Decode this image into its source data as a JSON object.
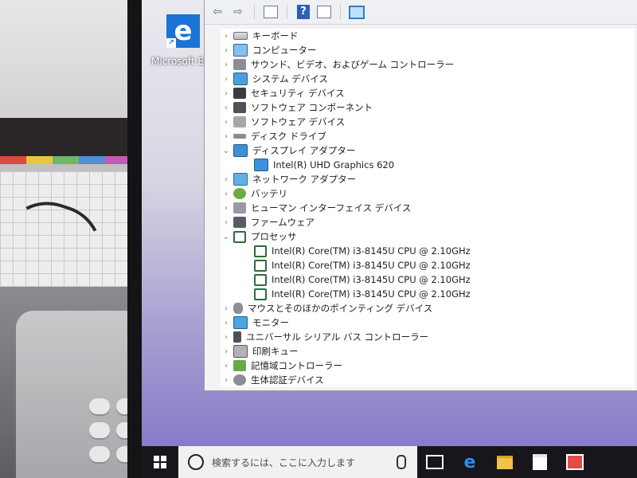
{
  "desktop": {
    "edge_shortcut_label": "Microsoft Ed"
  },
  "device_manager": {
    "categories": [
      {
        "label": "キーボード",
        "icon": "keyboard-icon"
      },
      {
        "label": "コンピューター",
        "icon": "computer-icon"
      },
      {
        "label": "サウンド、ビデオ、およびゲーム コントローラー",
        "icon": "speaker-icon"
      },
      {
        "label": "システム デバイス",
        "icon": "system-icon"
      },
      {
        "label": "セキュリティ デバイス",
        "icon": "security-icon"
      },
      {
        "label": "ソフトウェア コンポーネント",
        "icon": "software-component-icon"
      },
      {
        "label": "ソフトウェア デバイス",
        "icon": "software-device-icon"
      },
      {
        "label": "ディスク ドライブ",
        "icon": "disk-icon"
      },
      {
        "label": "ディスプレイ アダプター",
        "icon": "display-adapter-icon",
        "expanded": true,
        "children": [
          "Intel(R) UHD Graphics 620"
        ]
      },
      {
        "label": "ネットワーク アダプター",
        "icon": "network-icon"
      },
      {
        "label": "バッテリ",
        "icon": "battery-icon"
      },
      {
        "label": "ヒューマン インターフェイス デバイス",
        "icon": "hid-icon"
      },
      {
        "label": "ファームウェア",
        "icon": "firmware-icon"
      },
      {
        "label": "プロセッサ",
        "icon": "processor-icon",
        "expanded": true,
        "children": [
          "Intel(R) Core(TM) i3-8145U CPU @ 2.10GHz",
          "Intel(R) Core(TM) i3-8145U CPU @ 2.10GHz",
          "Intel(R) Core(TM) i3-8145U CPU @ 2.10GHz",
          "Intel(R) Core(TM) i3-8145U CPU @ 2.10GHz"
        ]
      },
      {
        "label": "マウスとそのほかのポインティング デバイス",
        "icon": "mouse-icon"
      },
      {
        "label": "モニター",
        "icon": "monitor-icon"
      },
      {
        "label": "ユニバーサル シリアル バス コントローラー",
        "icon": "usb-icon"
      },
      {
        "label": "印刷キュー",
        "icon": "printer-icon"
      },
      {
        "label": "記憶域コントローラー",
        "icon": "storage-icon"
      },
      {
        "label": "生体認証デバイス",
        "icon": "biometric-icon"
      }
    ]
  },
  "taskbar": {
    "search_placeholder": "検索するには、ここに入力します"
  }
}
